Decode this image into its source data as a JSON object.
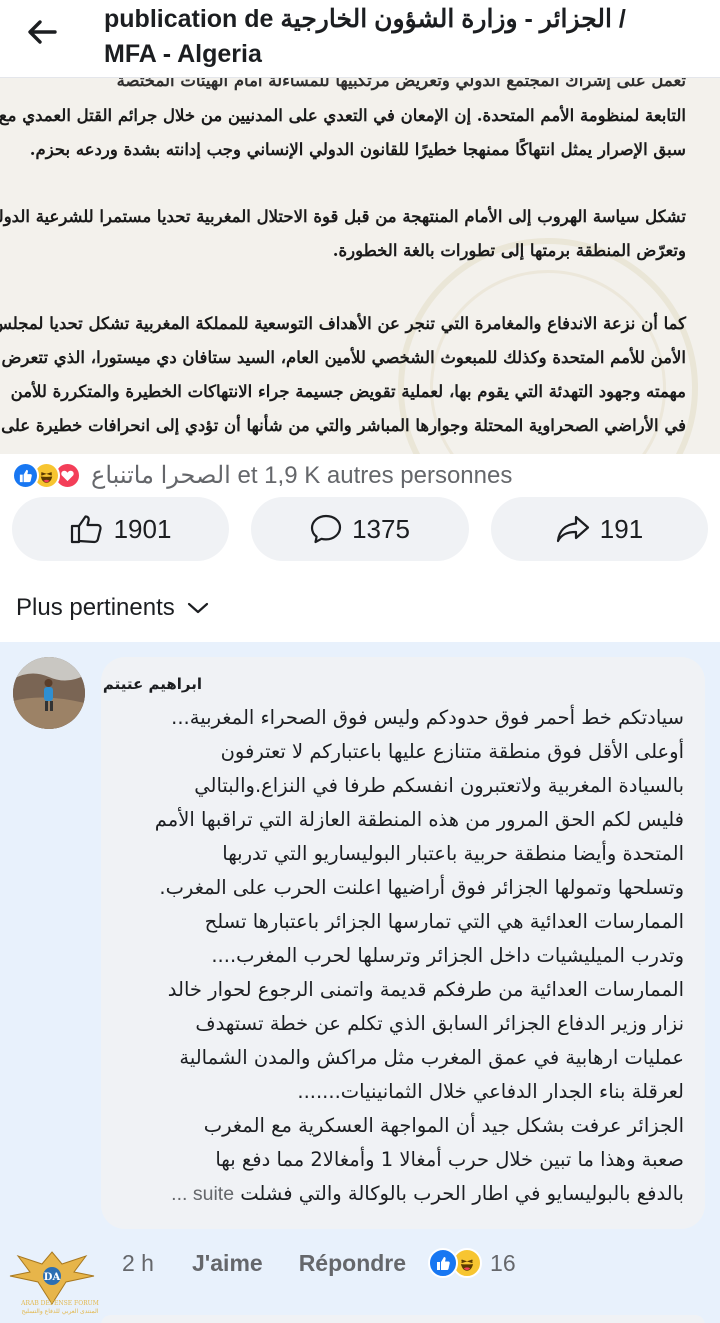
{
  "header": {
    "title_line1": "publication de الجزائر - وزارة الشؤون الخارجية /",
    "title_line2": "MFA - Algeria"
  },
  "document": {
    "lines": [
      "تعمل على إشراك المجتمع الدولي وتعريض مرتكبيها للمساءلة أمام الهيئات المختصة",
      "التابعة لمنظومة الأمم المتحدة. إن الإمعان في التعدي على المدنيين من خلال جرائم القتل العمدي مع",
      "سبق الإصرار يمثل انتهاكًا ممنهجا خطيرًا للقانون الدولي الإنساني وجب إدانته بشدة وردعه بحزم.",
      "تشكل سياسة الهروب إلى الأمام المنتهجة من قبل قوة الاحتلال المغربية تحديا مستمرا للشرعية الدولية،",
      "وتعرّض المنطقة برمتها إلى تطورات بالغة الخطورة.",
      "كما أن نزعة الاندفاع والمغامرة التي تنجر عن الأهداف التوسعية للمملكة المغربية تشكل تحديا لمجلس",
      "الأمن للأمم المتحدة وكذلك للمبعوث الشخصي للأمين العام، السيد ستافان دي ميستورا، الذي تتعرض",
      "مهمته وجهود التهدئة التي يقوم بها، لعملية تقويض جسيمة جراء الانتهاكات الخطيرة والمتكررة للأمن",
      "في الأراضي الصحراوية المحتلة وجوارها المباشر والتي من شأنها أن تؤدي إلى انحرافات خطيرة على"
    ]
  },
  "reactions": {
    "summary": "الصحرا ماتنباع et 1,9 K autres personnes",
    "icons": [
      "like-icon",
      "haha-icon",
      "love-icon"
    ]
  },
  "actions": {
    "likes": "1901",
    "comments": "1375",
    "shares": "191"
  },
  "sort": {
    "label": "Plus pertinents"
  },
  "comment": {
    "author": "ابراهيم عتيتم",
    "lines": [
      "سيادتكم خط أحمر فوق حدودكم وليس فوق الصحراء المغربية...",
      "أوعلى الأقل فوق منطقة متنازع عليها  باعتباركم لا تعترفون",
      "بالسيادة المغربية ولاتعتبرون انفسكم طرفا في النزاع.والبتالي",
      "فليس لكم الحق المرور من هذه المنطقة العازلة التي تراقبها الأمم",
      "المتحدة وأيضا منطقة حربية باعتبار البوليساريو التي تدربها",
      "وتسلحها وتمولها الجزائر فوق أراضيها اعلنت الحرب على المغرب.",
      "الممارسات العدائية هي التي تمارسها الجزائر باعتبارها تسلح",
      "وتدرب الميليشيات داخل الجزائر وترسلها لحرب المغرب....",
      "الممارسات العدائية من طرفكم قديمة واتمنى الرجوع لحوار خالد",
      "نزار وزير الدفاع الجزائر السابق الذي تكلم عن خطة تستهدف",
      "عمليات ارهابية في عمق المغرب مثل مراكش والمدن الشمالية",
      "لعرقلة بناء الجدار الدفاعي خلال الثمانينيات.......",
      "الجزائر عرفت بشكل جيد أن المواجهة العسكرية مع المغرب",
      "صعبة وهذا ما تبين خلال حرب أمغالا 1 وأمغالا2 مما دفع بها",
      "بالدفع بالبوليسايو في اطار الحرب بالوكالة والتي فشلت"
    ],
    "see_more": "suite ...",
    "time": "2 h",
    "like_label": "J'aime",
    "reply_label": "Répondre",
    "reaction_count": "16"
  },
  "watermark": {
    "line1": "ARAB DEFENSE FORUM",
    "line2": "المنتدى العربي للدفاع والتسليح"
  },
  "colors": {
    "accent": "#1877f2",
    "comment_bg": "#e8f1fc",
    "bubble_bg": "#f0f2f5",
    "muted_text": "#65676b"
  }
}
